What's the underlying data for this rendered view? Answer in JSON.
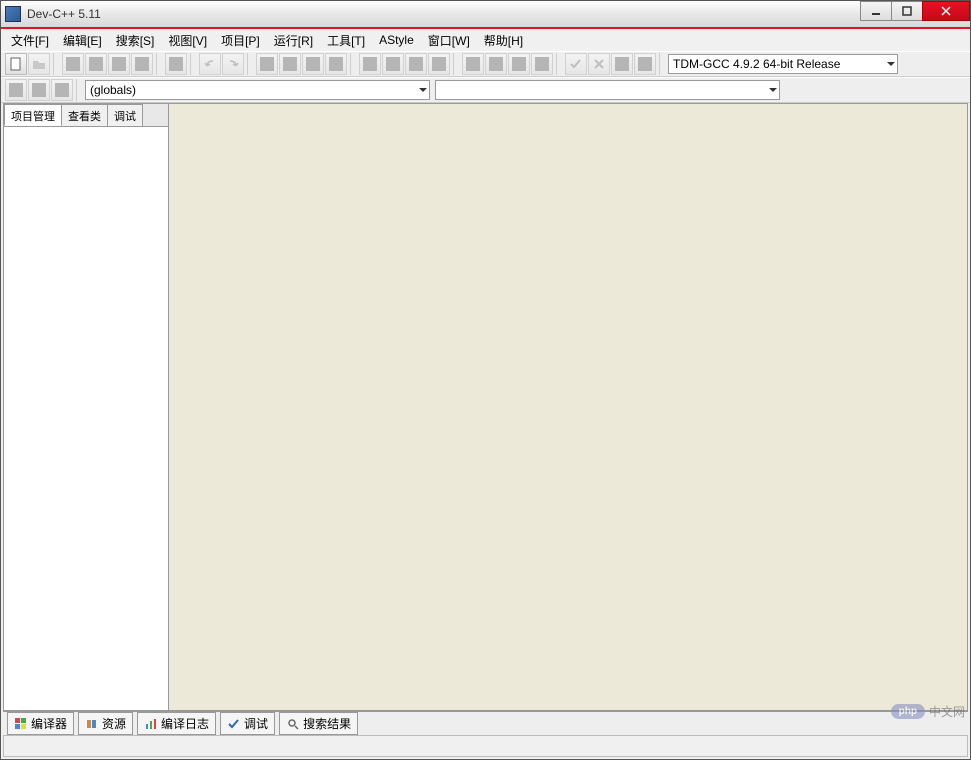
{
  "window": {
    "title": "Dev-C++ 5.11"
  },
  "menu": {
    "file": "文件[F]",
    "edit": "编辑[E]",
    "search": "搜索[S]",
    "view": "视图[V]",
    "project": "项目[P]",
    "run": "运行[R]",
    "tools": "工具[T]",
    "astyle": "AStyle",
    "window": "窗口[W]",
    "help": "帮助[H]"
  },
  "toolbar": {
    "compiler_combo": "TDM-GCC 4.9.2 64-bit Release",
    "scope_combo": "(globals)"
  },
  "sidebar": {
    "tabs": {
      "project": "项目管理",
      "classes": "查看类",
      "debug": "调试"
    }
  },
  "bottom": {
    "compiler": "编译器",
    "resources": "资源",
    "compile_log": "编译日志",
    "debug": "调试",
    "search_results": "搜索结果"
  },
  "watermark": {
    "badge": "php",
    "text": "中文网"
  }
}
